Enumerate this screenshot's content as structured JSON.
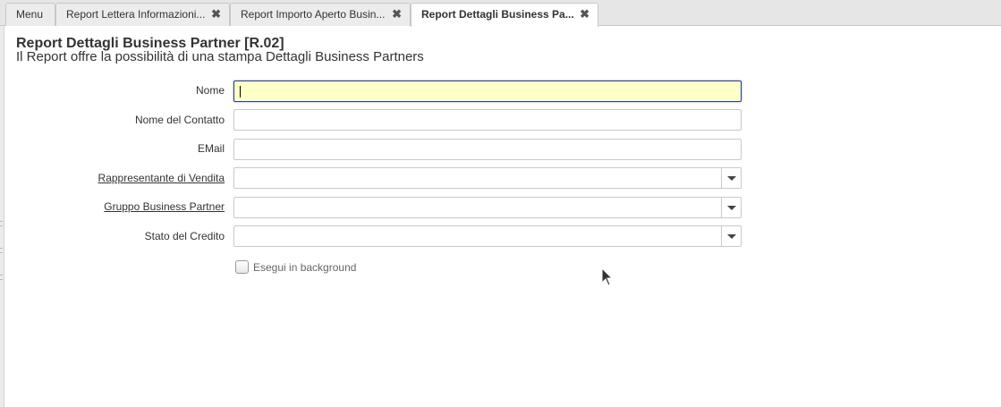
{
  "tabs": [
    {
      "label": "Menu",
      "closable": false,
      "active": false
    },
    {
      "label": "Report Lettera Informazioni...",
      "closable": true,
      "active": false
    },
    {
      "label": "Report Importo Aperto Busin...",
      "closable": true,
      "active": false
    },
    {
      "label": "Report Dettagli Business Pa...",
      "closable": true,
      "active": true
    }
  ],
  "tab_close_glyph": "✖",
  "form": {
    "title": "Report Dettagli Business Partner [R.02]",
    "description": "Il Report offre la possibilità di una stampa Dettagli Business Partners",
    "fields": {
      "nome": {
        "label": "Nome",
        "value": ""
      },
      "nome_contatto": {
        "label": "Nome del Contatto",
        "value": ""
      },
      "email": {
        "label": "EMail",
        "value": ""
      },
      "rappresentante": {
        "label": "Rappresentante di Vendita",
        "value": ""
      },
      "gruppo": {
        "label": "Gruppo Business Partner",
        "value": ""
      },
      "stato_credito": {
        "label": "Stato del Credito",
        "value": ""
      }
    },
    "background_checkbox": {
      "label": "Esegui in background",
      "checked": false
    }
  },
  "colors": {
    "focused_field_bg": "#ffffc8",
    "focused_field_border": "#283c96",
    "tabbar_bg": "#e6e6e6"
  }
}
